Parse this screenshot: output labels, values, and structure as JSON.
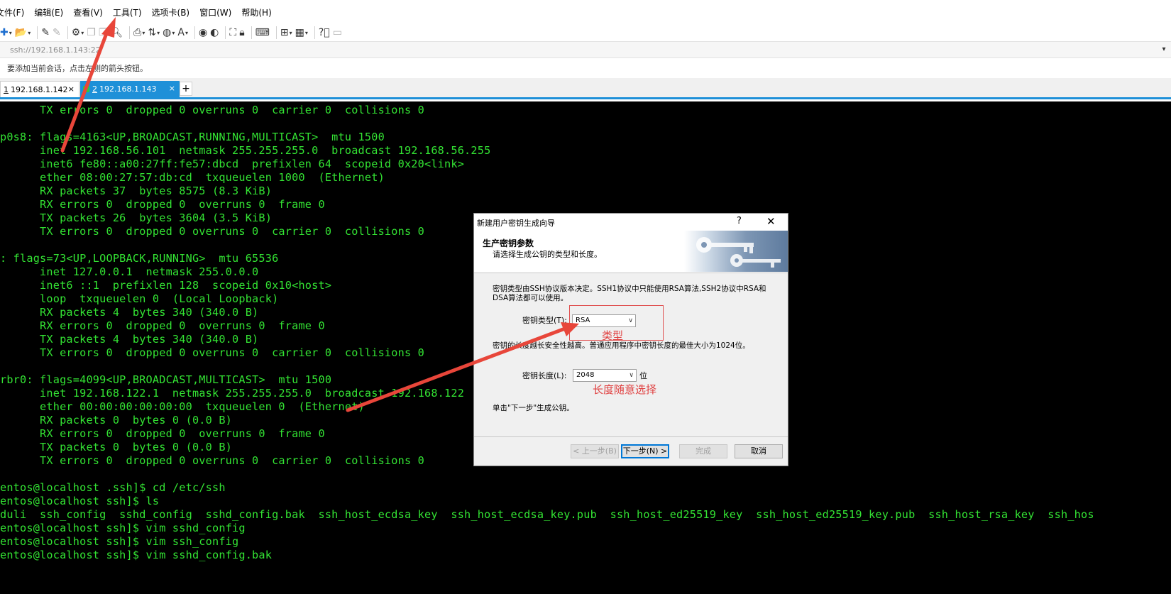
{
  "menu": [
    "文件(F)",
    "编辑(E)",
    "查看(V)",
    "工具(T)",
    "选项卡(B)",
    "窗口(W)",
    "帮助(H)"
  ],
  "address": "ssh://192.168.1.143:22",
  "hint": "要添加当前会话，点击左侧的箭头按钮。",
  "tabs": [
    {
      "num": "1",
      "label": "192.168.1.142",
      "active": false
    },
    {
      "num": "2",
      "label": "192.168.1.143",
      "active": true
    }
  ],
  "tab_add": "+",
  "tab_close": "×",
  "terminal_color": "#33e333",
  "terminal_lines": [
    "      TX errors 0  dropped 0 overruns 0  carrier 0  collisions 0",
    "",
    "p0s8: flags=4163<UP,BROADCAST,RUNNING,MULTICAST>  mtu 1500",
    "      inet 192.168.56.101  netmask 255.255.255.0  broadcast 192.168.56.255",
    "      inet6 fe80::a00:27ff:fe57:dbcd  prefixlen 64  scopeid 0x20<link>",
    "      ether 08:00:27:57:db:cd  txqueuelen 1000  (Ethernet)",
    "      RX packets 37  bytes 8575 (8.3 KiB)",
    "      RX errors 0  dropped 0  overruns 0  frame 0",
    "      TX packets 26  bytes 3604 (3.5 KiB)",
    "      TX errors 0  dropped 0 overruns 0  carrier 0  collisions 0",
    "",
    ": flags=73<UP,LOOPBACK,RUNNING>  mtu 65536",
    "      inet 127.0.0.1  netmask 255.0.0.0",
    "      inet6 ::1  prefixlen 128  scopeid 0x10<host>",
    "      loop  txqueuelen 0  (Local Loopback)",
    "      RX packets 4  bytes 340 (340.0 B)",
    "      RX errors 0  dropped 0  overruns 0  frame 0",
    "      TX packets 4  bytes 340 (340.0 B)",
    "      TX errors 0  dropped 0 overruns 0  carrier 0  collisions 0",
    "",
    "rbr0: flags=4099<UP,BROADCAST,MULTICAST>  mtu 1500",
    "      inet 192.168.122.1  netmask 255.255.255.0  broadcast 192.168.122",
    "      ether 00:00:00:00:00:00  txqueuelen 0  (Ethernet)",
    "      RX packets 0  bytes 0 (0.0 B)",
    "      RX errors 0  dropped 0  overruns 0  frame 0",
    "      TX packets 0  bytes 0 (0.0 B)",
    "      TX errors 0  dropped 0 overruns 0  carrier 0  collisions 0",
    "",
    "entos@localhost .ssh]$ cd /etc/ssh",
    "entos@localhost ssh]$ ls",
    "duli  ssh_config  sshd_config  sshd_config.bak  ssh_host_ecdsa_key  ssh_host_ecdsa_key.pub  ssh_host_ed25519_key  ssh_host_ed25519_key.pub  ssh_host_rsa_key  ssh_hos",
    "entos@localhost ssh]$ vim sshd_config",
    "entos@localhost ssh]$ vim ssh_config",
    "entos@localhost ssh]$ vim sshd_config.bak"
  ],
  "dialog": {
    "title": "新建用户密钥生成向导",
    "help": "?",
    "close": "✕",
    "heading": "生产密钥参数",
    "subheading": "请选择生成公钥的类型和长度。",
    "desc1_line1": "密钥类型由SSH协议版本决定。SSH1协议中只能使用RSA算法,SSH2协议中RSA和",
    "desc1_line2": "DSA算法都可以使用。",
    "key_type_label": "密钥类型(T):",
    "key_type_value": "RSA",
    "desc2": "密钥的长度越长安全性越高。普通应用程序中密钥长度的最佳大小为1024位。",
    "key_length_label": "密钥长度(L):",
    "key_length_value": "2048",
    "key_length_unit": "位",
    "next_hint": "单击\"下一步\"生成公钥。",
    "buttons": {
      "back": "< 上一步(B)",
      "next": "下一步(N) >",
      "finish": "完成",
      "cancel": "取消"
    }
  },
  "annotations": {
    "type_label": "类型",
    "length_label": "长度随意选择",
    "color": "#e04040"
  }
}
